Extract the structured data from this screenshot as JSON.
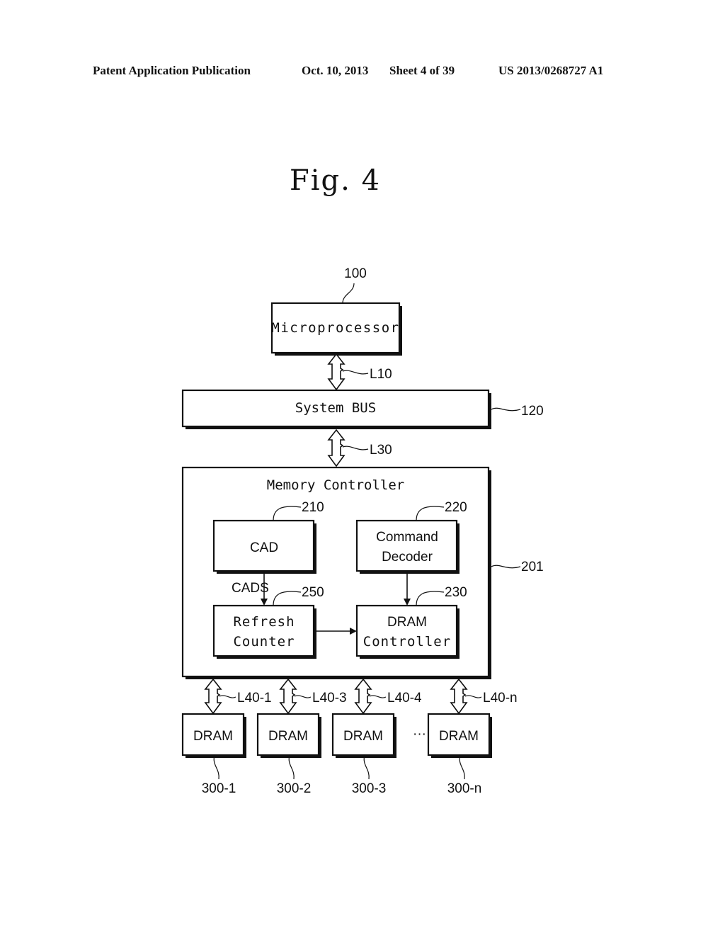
{
  "header": {
    "publication": "Patent Application Publication",
    "date": "Oct. 10, 2013",
    "sheet": "Sheet 4 of 39",
    "patent_number": "US 2013/0268727 A1"
  },
  "figure": {
    "title": "Fig. 4",
    "blocks": {
      "microprocessor": {
        "label": "Microprocessor",
        "ref": "100"
      },
      "system_bus": {
        "label": "System BUS",
        "ref": "120"
      },
      "memory_controller": {
        "label": "Memory Controller",
        "ref": "201"
      },
      "cad": {
        "label": "CAD",
        "ref": "210"
      },
      "command_decoder": {
        "label_line1": "Command",
        "label_line2": "Decoder",
        "ref": "220"
      },
      "refresh_counter": {
        "label_line1": "Refresh",
        "label_line2": "Counter",
        "ref": "250"
      },
      "dram_controller": {
        "label_line1": "DRAM",
        "label_line2": "Controller",
        "ref": "230"
      }
    },
    "signals": {
      "cads": "CADS"
    },
    "links": {
      "l10": "L10",
      "l30": "L30",
      "l40": [
        "L40-1",
        "L40-3",
        "L40-4",
        "L40-n"
      ]
    },
    "drams": [
      {
        "label": "DRAM",
        "ref": "300-1"
      },
      {
        "label": "DRAM",
        "ref": "300-2"
      },
      {
        "label": "DRAM",
        "ref": "300-3"
      },
      {
        "label": "DRAM",
        "ref": "300-n"
      }
    ],
    "ellipsis": "···"
  }
}
